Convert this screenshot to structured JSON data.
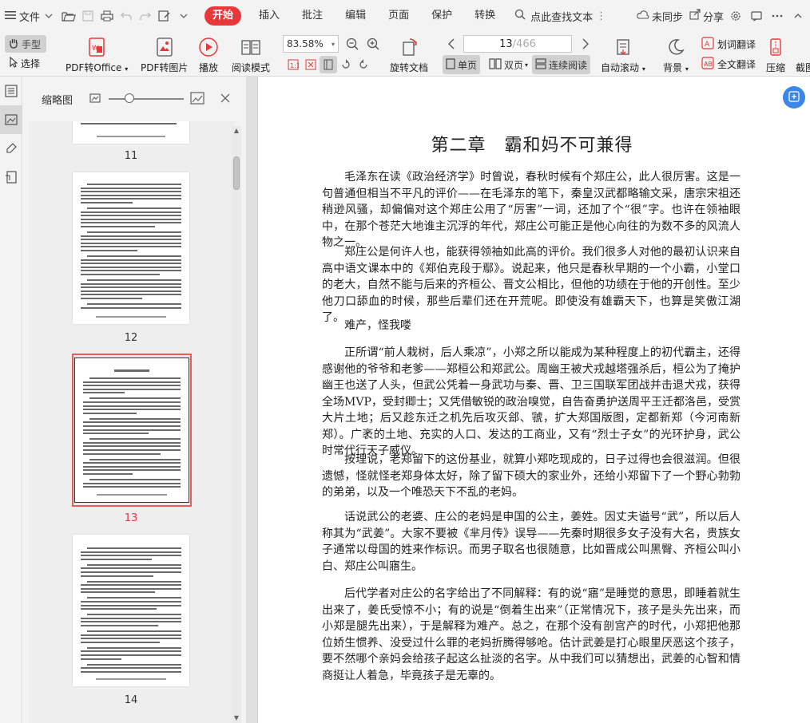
{
  "menubar": {
    "file_label": "文件",
    "tabs": [
      "开始",
      "插入",
      "批注",
      "编辑",
      "页面",
      "保护",
      "转换"
    ],
    "active_tab": "开始",
    "find_label": "点此查找文本",
    "sync_label": "未同步",
    "share_label": "分享"
  },
  "ribbon": {
    "hand_label": "手型",
    "select_label": "选择",
    "pdf_to_office": "PDF转Office",
    "pdf_to_image": "PDF转图片",
    "play": "播放",
    "read_mode": "阅读模式",
    "zoom": "83.58%",
    "page_current": "13",
    "page_total": "/466",
    "rotate": "旋转文档",
    "single": "单页",
    "double": "双页",
    "continuous": "连续阅读",
    "auto_scroll": "自动滚动",
    "background": "背景",
    "word_translate": "划词翻译",
    "full_translate": "全文翻译",
    "compress": "压缩",
    "crop": "截图"
  },
  "sidebar": {
    "title": "缩略图",
    "pages": [
      {
        "number": "11"
      },
      {
        "number": "12"
      },
      {
        "number": "13"
      },
      {
        "number": "14"
      }
    ],
    "selected_page": "13"
  },
  "document": {
    "chapter_title": "第二章　霸和妈不可兼得",
    "paragraphs": [
      "毛泽东在读《政治经济学》时曾说，春秋时候有个郑庄公，此人很厉害。这是一句普通但相当不平凡的评价——在毛泽东的笔下，秦皇汉武都略输文采，唐宗宋祖还稍逊风骚，却偏偏对这个郑庄公用了“厉害”一词，还加了个“很”字。也许在领袖眼中，在那个苍茫大地谁主沉浮的年代，郑庄公可能正是他心向往的为数不多的风流人物之一。",
      "郑庄公是何许人也，能获得领袖如此高的评价。我们很多人对他的最初认识来自高中语文课本中的《郑伯克段于鄢》。说起来，他只是春秋早期的一个小霸，小堂口的老大，自然不能与后来的齐桓公、晋文公相比，但他的功绩在于他的开创性。至少他刀口舔血的时候，那些后辈们还在开荒呢。即使没有雄霸天下，也算是笑傲江湖了。",
      "难产，怪我喽",
      "正所谓“前人栽树，后人乘凉”，小郑之所以能成为某种程度上的初代霸主，还得感谢他的爷爷和老爹——郑桓公和郑武公。周幽王被犬戎越塔强杀后，桓公为了掩护幽王也送了人头，但武公凭着一身武功与秦、晋、卫三国联军团战并击退犬戎，获得全场MVP，受封卿士；又凭借敏锐的政治嗅觉，自告奋勇护送周平王迁都洛邑，受赏大片土地；后又趁东迁之机先后攻灭郐、虢，扩大郑国版图，定都新郑（今河南新郑）。广袤的土地、充实的人口、发达的工商业，又有“烈士子女”的光环护身，武公时常代行天子威仪。",
      "按理说，老郑留下的这份基业，就算小郑吃现成的，日子过得也会很滋润。但很遗憾，怪就怪老郑身体太好，除了留下硕大的家业外，还给小郑留下了一个野心勃勃的弟弟，以及一个唯恐天下不乱的老妈。",
      "话说武公的老婆、庄公的老妈是申国的公主，姜姓。因丈夫谥号“武”，所以后人称其为“武姜”。大家不要被《芈月传》误导——先秦时期很多女子没有大名，贵族女子通常以母国的姓来作标识。而男子取名也很随意，比如晋成公叫黑臀、齐桓公叫小白、郑庄公叫寤生。",
      "后代学者对庄公的名字给出了不同解释：有的说“寤”是睡觉的意思，即睡着就生出来了，姜氏受惊不小；有的说是“倒着生出来”（正常情况下，孩子是头先出来，而小郑是腿先出来），于是解释为难产。总之，在那个没有剖宫产的时代，小郑把他那位娇生惯养、没受过什么罪的老妈折腾得够呛。估计武姜是打心眼里厌恶这个孩子，要不然哪个亲妈会给孩子起这么扯淡的名字。从中我们可以猜想出，武姜的心智和情商挺让人着急，毕竟孩子是无辜的。"
    ]
  },
  "colors": {
    "accent_red": "#e8373a",
    "float_blue": "#3c86e8"
  }
}
